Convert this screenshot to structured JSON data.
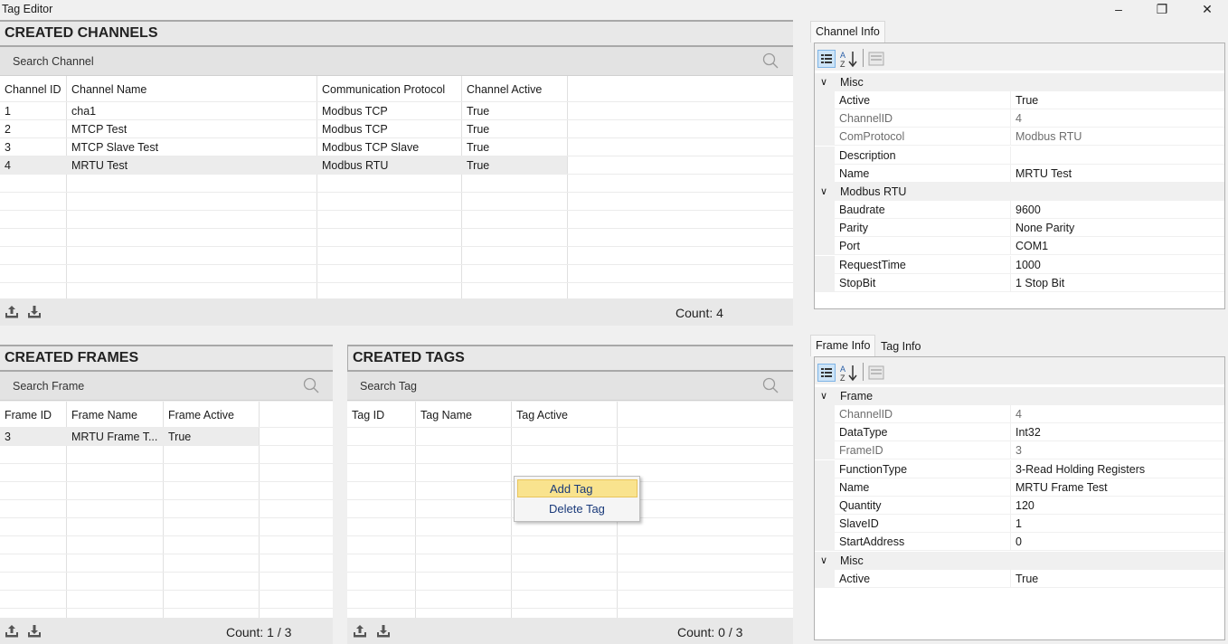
{
  "window": {
    "title": "Tag Editor",
    "min_icon": "–",
    "max_icon": "❐",
    "close_icon": "✕"
  },
  "channels": {
    "title": "CREATED CHANNELS",
    "search_placeholder": "Search Channel",
    "columns": [
      "Channel ID",
      "Channel Name",
      "Communication Protocol",
      "Channel Active"
    ],
    "rows": [
      [
        "1",
        "cha1",
        "Modbus TCP",
        "True"
      ],
      [
        "2",
        "MTCP Test",
        "Modbus TCP",
        "True"
      ],
      [
        "3",
        "MTCP Slave Test",
        "Modbus TCP Slave",
        "True"
      ],
      [
        "4",
        "MRTU Test",
        "Modbus RTU",
        "True"
      ]
    ],
    "count": "Count: 4"
  },
  "frames": {
    "title": "CREATED FRAMES",
    "search_placeholder": "Search Frame",
    "columns": [
      "Frame ID",
      "Frame Name",
      "Frame Active"
    ],
    "rows": [
      [
        "3",
        "MRTU Frame T...",
        "True"
      ]
    ],
    "count": "Count: 1 / 3"
  },
  "tags": {
    "title": "CREATED TAGS",
    "search_placeholder": "Search Tag",
    "columns": [
      "Tag ID",
      "Tag Name",
      "Tag Active"
    ],
    "rows": [],
    "count": "Count: 0 / 3"
  },
  "context_menu": {
    "items": [
      "Add Tag",
      "Delete Tag"
    ]
  },
  "channel_info": {
    "tab": "Channel Info",
    "sections": [
      {
        "name": "Misc",
        "props": [
          [
            "Active",
            "True"
          ],
          [
            "ChannelID",
            "4"
          ],
          [
            "ComProtocol",
            "Modbus RTU"
          ],
          [
            "Description",
            ""
          ],
          [
            "Name",
            "MRTU Test"
          ]
        ]
      },
      {
        "name": "Modbus RTU",
        "props": [
          [
            "Baudrate",
            "9600"
          ],
          [
            "Parity",
            "None Parity"
          ],
          [
            "Port",
            "COM1"
          ],
          [
            "RequestTime",
            "1000"
          ],
          [
            "StopBit",
            "1 Stop Bit"
          ]
        ]
      }
    ]
  },
  "frame_info": {
    "tabs": [
      "Frame Info",
      "Tag Info"
    ],
    "sections": [
      {
        "name": "Frame",
        "props": [
          [
            "ChannelID",
            "4"
          ],
          [
            "DataType",
            "Int32"
          ],
          [
            "FrameID",
            "3"
          ],
          [
            "FunctionType",
            "3-Read Holding Registers"
          ],
          [
            "Name",
            "MRTU Frame Test"
          ],
          [
            "Quantity",
            "120"
          ],
          [
            "SlaveID",
            "1"
          ],
          [
            "StartAddress",
            "0"
          ]
        ]
      },
      {
        "name": "Misc",
        "props": [
          [
            "Active",
            "True"
          ]
        ]
      }
    ]
  },
  "icons": [
    "upload-icon",
    "download-icon",
    "search-icon",
    "categorized-icon",
    "alphabetical-icon",
    "property-pages-icon",
    "chevron-down-icon"
  ]
}
